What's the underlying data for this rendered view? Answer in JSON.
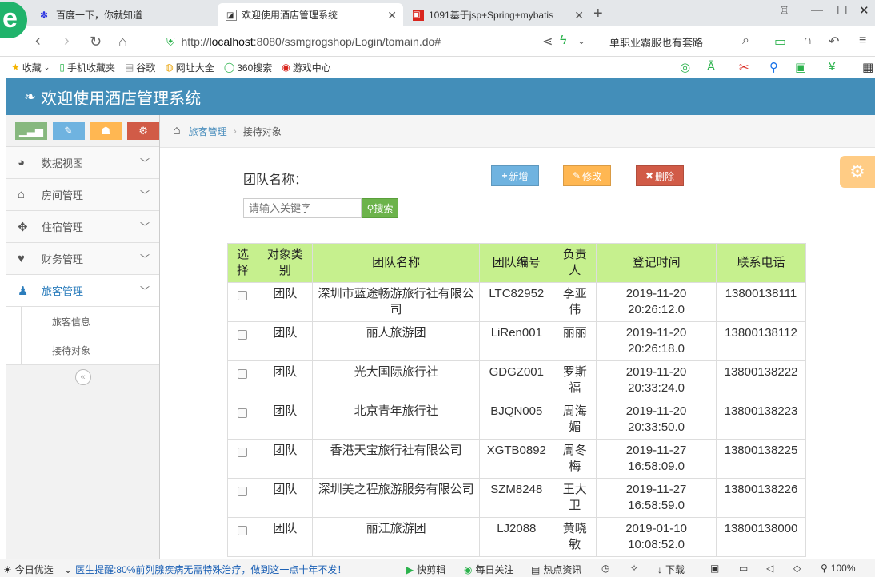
{
  "browser": {
    "tabs": [
      {
        "title": "百度一下，你就知道",
        "icon": "baidu-paw-icon"
      },
      {
        "title": "欢迎使用酒店管理系统",
        "icon": "page-icon"
      },
      {
        "title": "1091基于jsp+Spring+mybatis",
        "icon": "red-page-icon"
      }
    ],
    "url_prefix": "http://",
    "url_host": "localhost",
    "url_rest": ":8080/ssmgrogshop/Login/tomain.do#",
    "search_text": "单职业霸服也有套路",
    "bookmarks": [
      "收藏",
      "手机收藏夹",
      "谷歌",
      "网址大全",
      "360搜索",
      "游戏中心"
    ]
  },
  "app": {
    "title": "欢迎使用酒店管理系统"
  },
  "sidebar": {
    "shortcut_colors": [
      "#87b87f",
      "#6fb3e0",
      "#ffb752",
      "#d15b47"
    ],
    "items": [
      {
        "label": "数据视图",
        "icon": "dashboard-icon"
      },
      {
        "label": "房间管理",
        "icon": "home-icon"
      },
      {
        "label": "住宿管理",
        "icon": "move-arrows-icon"
      },
      {
        "label": "财务管理",
        "icon": "heart-icon"
      },
      {
        "label": "旅客管理",
        "icon": "user-icon"
      }
    ],
    "subitems": [
      "旅客信息",
      "接待对象"
    ]
  },
  "breadcrumb": {
    "parent": "旅客管理",
    "current": "接待对象"
  },
  "toolbar": {
    "team_label": "团队名称：",
    "add_label": "新增",
    "edit_label": "修改",
    "delete_label": "删除",
    "search_placeholder": "请输入关键字",
    "search_label": "搜索"
  },
  "table": {
    "headers": [
      "选择",
      "对象类别",
      "团队名称",
      "团队编号",
      "负责人",
      "登记时间",
      "联系电话"
    ],
    "rows": [
      {
        "type": "团队",
        "name": "深圳市蓝途畅游旅行社有限公司",
        "code": "LTC82952",
        "leader": "李亚伟",
        "time": "2019-11-20 20:26:12.0",
        "phone": "13800138111"
      },
      {
        "type": "团队",
        "name": "丽人旅游团",
        "code": "LiRen001",
        "leader": "丽丽",
        "time": "2019-11-20 20:26:18.0",
        "phone": "13800138112"
      },
      {
        "type": "团队",
        "name": "光大国际旅行社",
        "code": "GDGZ001",
        "leader": "罗斯福",
        "time": "2019-11-20 20:33:24.0",
        "phone": "13800138222"
      },
      {
        "type": "团队",
        "name": "北京青年旅行社",
        "code": "BJQN005",
        "leader": "周海媚",
        "time": "2019-11-20 20:33:50.0",
        "phone": "13800138223"
      },
      {
        "type": "团队",
        "name": "香港天宝旅行社有限公司",
        "code": "XGTB0892",
        "leader": "周冬梅",
        "time": "2019-11-27 16:58:09.0",
        "phone": "13800138225"
      },
      {
        "type": "团队",
        "name": "深圳美之程旅游服务有限公司",
        "code": "SZM8248",
        "leader": "王大卫",
        "time": "2019-11-27 16:58:59.0",
        "phone": "13800138226"
      },
      {
        "type": "团队",
        "name": "丽江旅游团",
        "code": "LJ2088",
        "leader": "黄晓敏",
        "time": "2019-01-10 10:08:52.0",
        "phone": "13800138000"
      }
    ]
  },
  "statusbar": {
    "left": "今日优选",
    "news": "医生提醒:80%前列腺疾病无需特殊治疗，做到这一点十年不发！",
    "items": [
      "快剪辑",
      "每日关注",
      "热点资讯",
      "下载"
    ],
    "zoom": "100%"
  }
}
